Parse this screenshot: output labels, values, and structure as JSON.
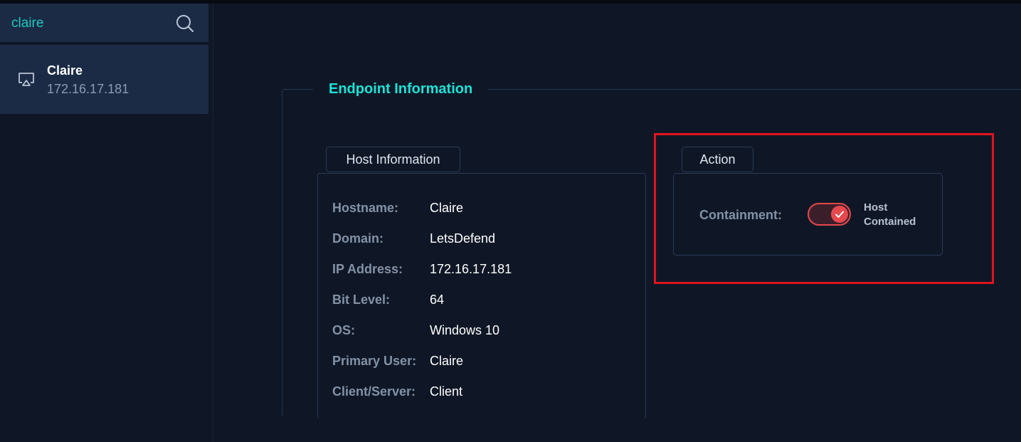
{
  "sidebar": {
    "search": {
      "value": "claire",
      "icon": "search-icon"
    },
    "hosts": [
      {
        "name": "Claire",
        "ip": "172.16.17.181",
        "icon": "monitor-icon"
      }
    ]
  },
  "main": {
    "section_title": "Endpoint Information",
    "host_info": {
      "tab_label": "Host Information",
      "rows": [
        {
          "key": "Hostname:",
          "value": "Claire"
        },
        {
          "key": "Domain:",
          "value": "LetsDefend"
        },
        {
          "key": "IP Address:",
          "value": "172.16.17.181"
        },
        {
          "key": "Bit Level:",
          "value": "64"
        },
        {
          "key": "OS:",
          "value": "Windows 10"
        },
        {
          "key": "Primary User:",
          "value": "Claire"
        },
        {
          "key": "Client/Server:",
          "value": "Client"
        }
      ]
    },
    "action": {
      "tab_label": "Action",
      "containment_label": "Containment:",
      "toggle_on": true,
      "status_line1": "Host",
      "status_line2": "Contained"
    }
  },
  "colors": {
    "accent": "#1de2d6",
    "toggle_active": "#e5484d",
    "highlight": "#e0141f",
    "background": "#0f1726",
    "panel": "#1b2b45"
  }
}
